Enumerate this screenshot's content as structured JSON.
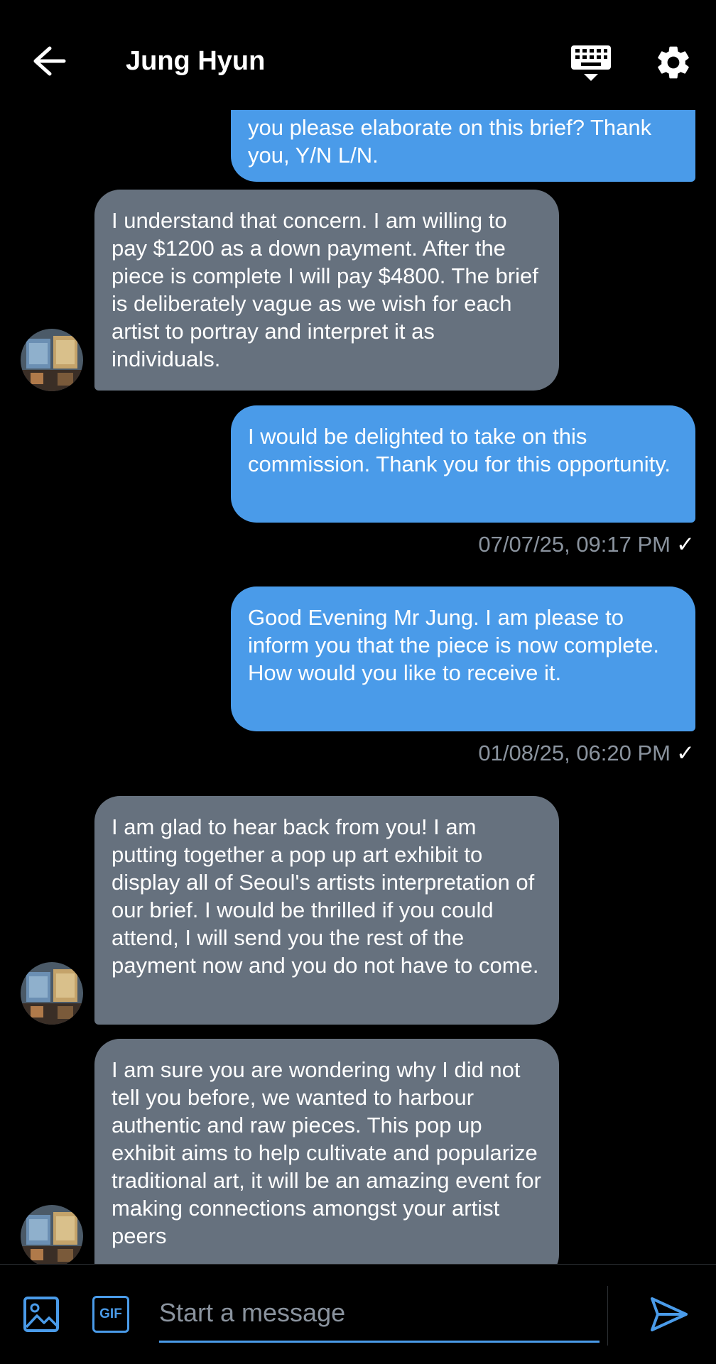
{
  "header": {
    "title": "Jung Hyun"
  },
  "messages": [
    {
      "dir": "out",
      "text": "you please elaborate on this brief? Thank you, Y/N L/N."
    },
    {
      "dir": "in",
      "text": "I understand that concern. I am willing to pay $1200 as a down payment. After the piece is complete I will pay $4800. The brief is deliberately vague as we wish for each artist to portray and interpret it as individuals."
    },
    {
      "dir": "out",
      "text": "I would be delighted to take on this commission. Thank you for this opportunity.",
      "meta": "07/07/25, 09:17 PM",
      "tick": "✓"
    },
    {
      "dir": "out",
      "text": "Good Evening Mr Jung. I am please to inform you that the piece is now complete. How would you like to receive it.",
      "meta": "01/08/25, 06:20 PM",
      "tick": "✓"
    },
    {
      "dir": "in",
      "text": "I am glad to hear back from you! I am putting together a pop up art exhibit to display all of Seoul's artists interpretation of our brief. I would be thrilled if you could attend, I will send you the rest of the payment now and you do not have to come."
    },
    {
      "dir": "in",
      "text": "I am sure you are wondering why I did not tell you before, we wanted to harbour authentic and raw pieces. This pop up exhibit aims to help cultivate and popularize traditional art, it will be an amazing event for making connections amongst your artist peers"
    }
  ],
  "composer": {
    "placeholder": "Start a message",
    "gif_label": "GIF"
  },
  "colors": {
    "outgoing": "#4a9be9",
    "incoming": "#66717e",
    "accent": "#4a9be9"
  },
  "icons": [
    "back-arrow-icon",
    "keyboard-icon",
    "gear-icon",
    "image-icon",
    "gif-icon",
    "send-icon"
  ]
}
